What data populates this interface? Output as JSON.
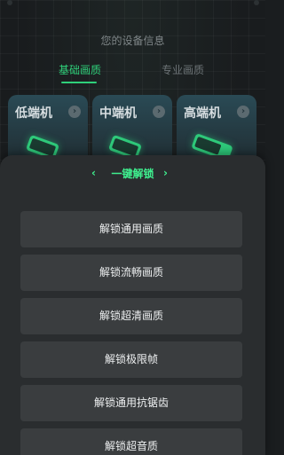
{
  "header": {
    "title": "您的设备信息"
  },
  "tabs": [
    {
      "label": "基础画质",
      "active": true
    },
    {
      "label": "专业画质",
      "active": false
    }
  ],
  "tiers": [
    {
      "label": "低端机"
    },
    {
      "label": "中端机"
    },
    {
      "label": "高端机"
    }
  ],
  "sheet": {
    "title": "一键解锁",
    "options": [
      "解锁通用画质",
      "解锁流畅画质",
      "解锁超清画质",
      "解锁极限帧",
      "解锁通用抗锯齿",
      "解锁超音质"
    ]
  },
  "colors": {
    "accent": "#2fd07a",
    "accent_bright": "#3ff08f",
    "background": "#191c1e",
    "sheet": "#2a2d2f",
    "button": "#3a3d3f"
  }
}
